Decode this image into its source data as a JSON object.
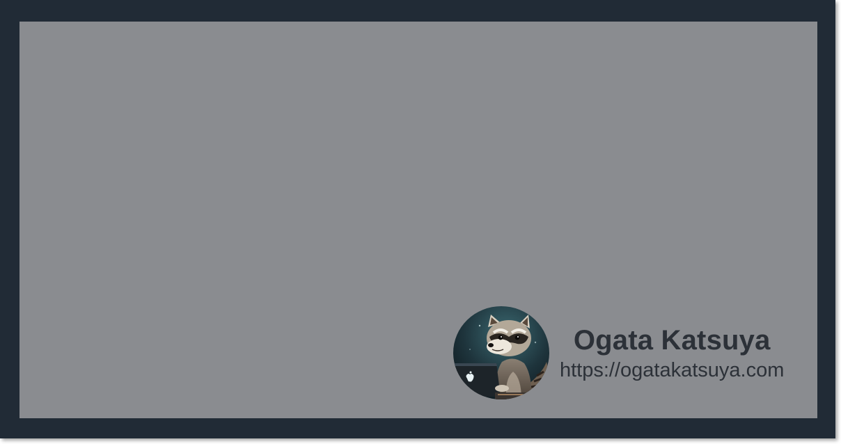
{
  "author": {
    "name": "Ogata Katsuya",
    "url": "https://ogatakatsuya.com",
    "avatar_icon": "raccoon-with-laptop-avatar"
  },
  "colors": {
    "frame": "#212b36",
    "card": "#8a8c90",
    "text": "#2c3138"
  }
}
